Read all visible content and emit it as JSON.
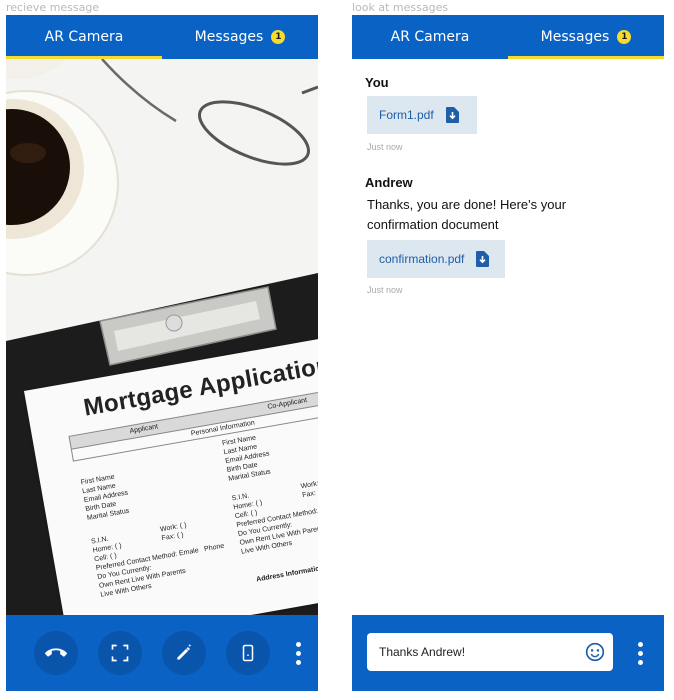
{
  "captions": {
    "left": "recieve message",
    "right": "look at messages"
  },
  "tabs": {
    "camera": "AR Camera",
    "messages": "Messages",
    "badge_count": "1"
  },
  "camera_scene": {
    "form_title": "Mortgage Application",
    "headers": [
      "Applicant",
      "Co-Applicant"
    ],
    "section": "Personal Information",
    "fields": [
      "First Name",
      "Last Name",
      "Email Address",
      "Birth Date",
      "Marital Status"
    ],
    "contact_fields": [
      "S.I.N.",
      "Home: (     )",
      "Cell: (     )",
      "Preferred Contact Method: Emale",
      "Do You Currently:",
      "Own      Rent      Live With Parents",
      "Live With Others"
    ],
    "work_fields": [
      "Work: (     )",
      "Fax: (     )"
    ],
    "phone_label": "Phone",
    "address_section": "Address Information"
  },
  "toolbar": {
    "icons": [
      "hang-up-icon",
      "fullscreen-icon",
      "draw-icon",
      "device-icon",
      "more-icon"
    ]
  },
  "conversation": [
    {
      "sender": "You",
      "text": "",
      "attachment": "Form1.pdf",
      "time": "Just now"
    },
    {
      "sender": "Andrew",
      "text": "Thanks, you are done! Here's your confirmation document",
      "attachment": "confirmation.pdf",
      "time": "Just now"
    }
  ],
  "composer": {
    "value": "Thanks Andrew!",
    "emoji_icon": "emoji-icon"
  },
  "colors": {
    "primary": "#0a63c4",
    "accent": "#f3db2f",
    "attachment_bg": "#dde7f0",
    "link": "#1f5ea8"
  }
}
